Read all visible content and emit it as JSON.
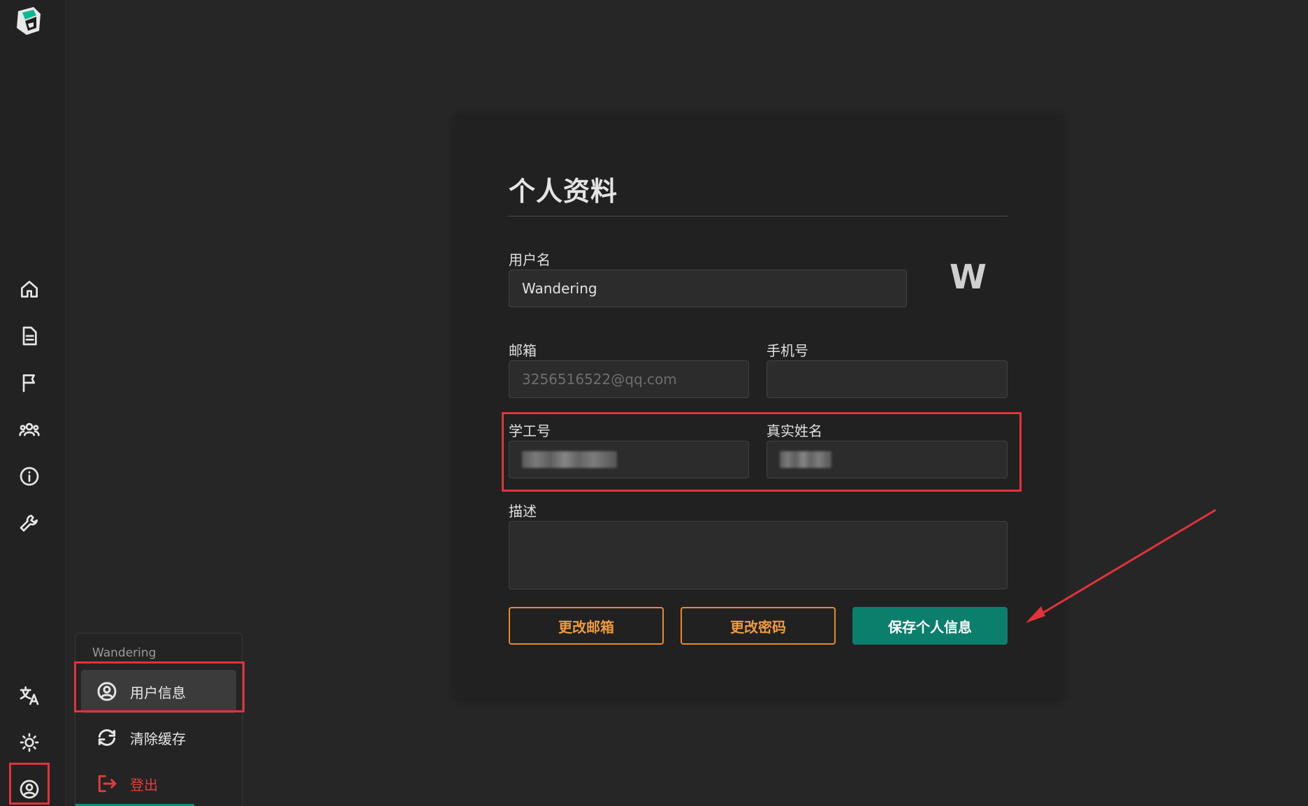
{
  "sidebar": {
    "nav": [
      {
        "name": "home-icon"
      },
      {
        "name": "document-icon"
      },
      {
        "name": "flag-icon"
      },
      {
        "name": "users-icon"
      },
      {
        "name": "info-icon"
      },
      {
        "name": "wrench-icon"
      }
    ],
    "bottom": [
      {
        "name": "translate-icon"
      },
      {
        "name": "theme-sun-icon"
      },
      {
        "name": "user-circle-icon"
      }
    ]
  },
  "user_menu": {
    "username": "Wandering",
    "items": [
      {
        "label": "用户信息",
        "icon": "user-circle-icon"
      },
      {
        "label": "清除缓存",
        "icon": "refresh-icon"
      },
      {
        "label": "登出",
        "icon": "logout-icon"
      }
    ]
  },
  "profile": {
    "title": "个人资料",
    "avatar_letter": "W",
    "username_label": "用户名",
    "username_value": "Wandering",
    "email_label": "邮箱",
    "email_value": "3256516522@qq.com",
    "phone_label": "手机号",
    "phone_value": "",
    "student_id_label": "学工号",
    "real_name_label": "真实姓名",
    "description_label": "描述",
    "description_value": "",
    "buttons": {
      "change_email": "更改邮箱",
      "change_password": "更改密码",
      "save": "保存个人信息"
    }
  },
  "colors": {
    "accent_teal": "#0c7e6c",
    "accent_orange": "#e78a2e",
    "highlight_red": "#e2323c"
  }
}
